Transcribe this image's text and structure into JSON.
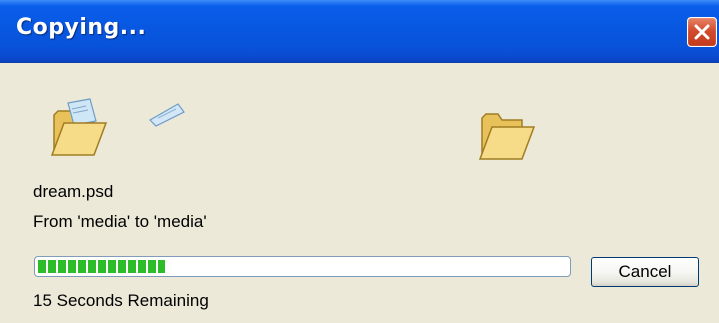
{
  "dialog": {
    "title": "Copying...",
    "file_name": "dream.psd",
    "from_to": "From 'media' to 'media'",
    "progress_fraction": 0.24,
    "time_remaining": "15 Seconds Remaining",
    "cancel_label": "Cancel"
  },
  "icons": {
    "close": "close-icon",
    "source_folder": "open-folder-icon",
    "flying_document": "flying-document-icon",
    "destination_folder": "open-folder-icon"
  },
  "colors": {
    "title_bar": "#0A5EEB",
    "close_button": "#D24C2C",
    "progress_fill": "#2DBD28",
    "background": "#ECE9D8"
  }
}
